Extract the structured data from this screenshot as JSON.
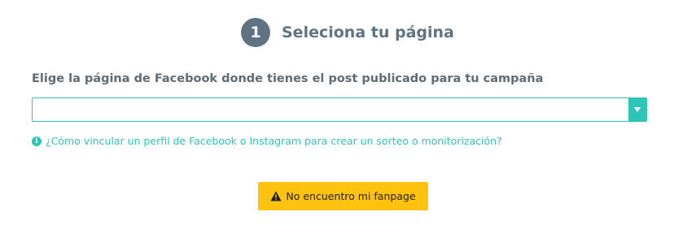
{
  "step": {
    "number": "1",
    "title": "Seleciona tu página"
  },
  "field": {
    "label": "Elige la página de Facebook donde tienes el post publicado para tu campaña",
    "selected_value": ""
  },
  "help_link": {
    "icon": "info-icon",
    "text": "¿Cómo vincular un perfil de Facebook o Instagram para crear un sorteo o monitorización?"
  },
  "warning_button": {
    "icon": "warning-triangle-icon",
    "label": "No encuentro mi fanpage"
  },
  "colors": {
    "accent": "#2ec5b6",
    "step_badge": "#5f7383",
    "warning": "#ffc20e"
  }
}
